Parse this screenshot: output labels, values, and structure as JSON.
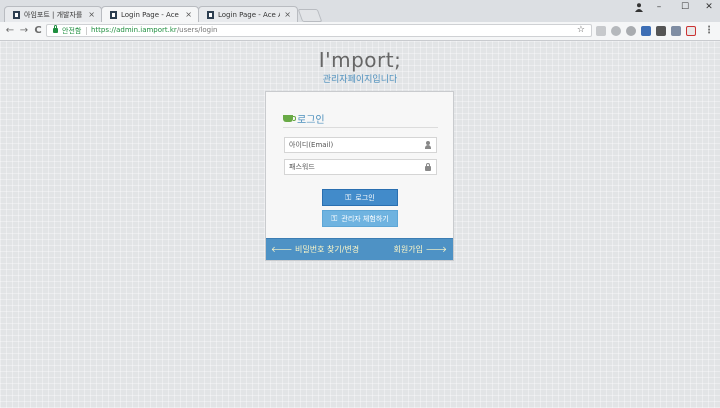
{
  "browser": {
    "tabs": [
      {
        "title": "아임포트 | 개발자를 위한",
        "close": "×"
      },
      {
        "title": "Login Page - Ace Admin",
        "close": "×"
      },
      {
        "title": "Login Page - Ace Admin",
        "close": "×"
      }
    ],
    "window_controls": {
      "minimize": "–",
      "maximize": "☐",
      "close": "✕"
    },
    "nav": {
      "back": "←",
      "forward": "→",
      "reload": "C"
    },
    "address": {
      "security_label": "안전함",
      "url_host": "https://admin.iamport.kr",
      "url_path": "/users/login"
    },
    "bookmark": "☆",
    "menu": "⋮"
  },
  "page": {
    "brand_title": "I'mport;",
    "brand_subtitle": "관리자페이지입니다",
    "login_box": {
      "heading": "로그인",
      "email_placeholder": "아이디(Email)",
      "password_placeholder": "패스워드",
      "login_button": "로그인",
      "experience_button": "관리자 체험하기",
      "forgot_link": "비밀번호 찾기/변경",
      "signup_link": "회원가입"
    }
  },
  "colors": {
    "accent": "#4c8fbd",
    "login_button": "#428bca",
    "experience_button": "#6fb3e0",
    "footer": "#4e92c5",
    "secure_green": "#1e8e3e"
  }
}
